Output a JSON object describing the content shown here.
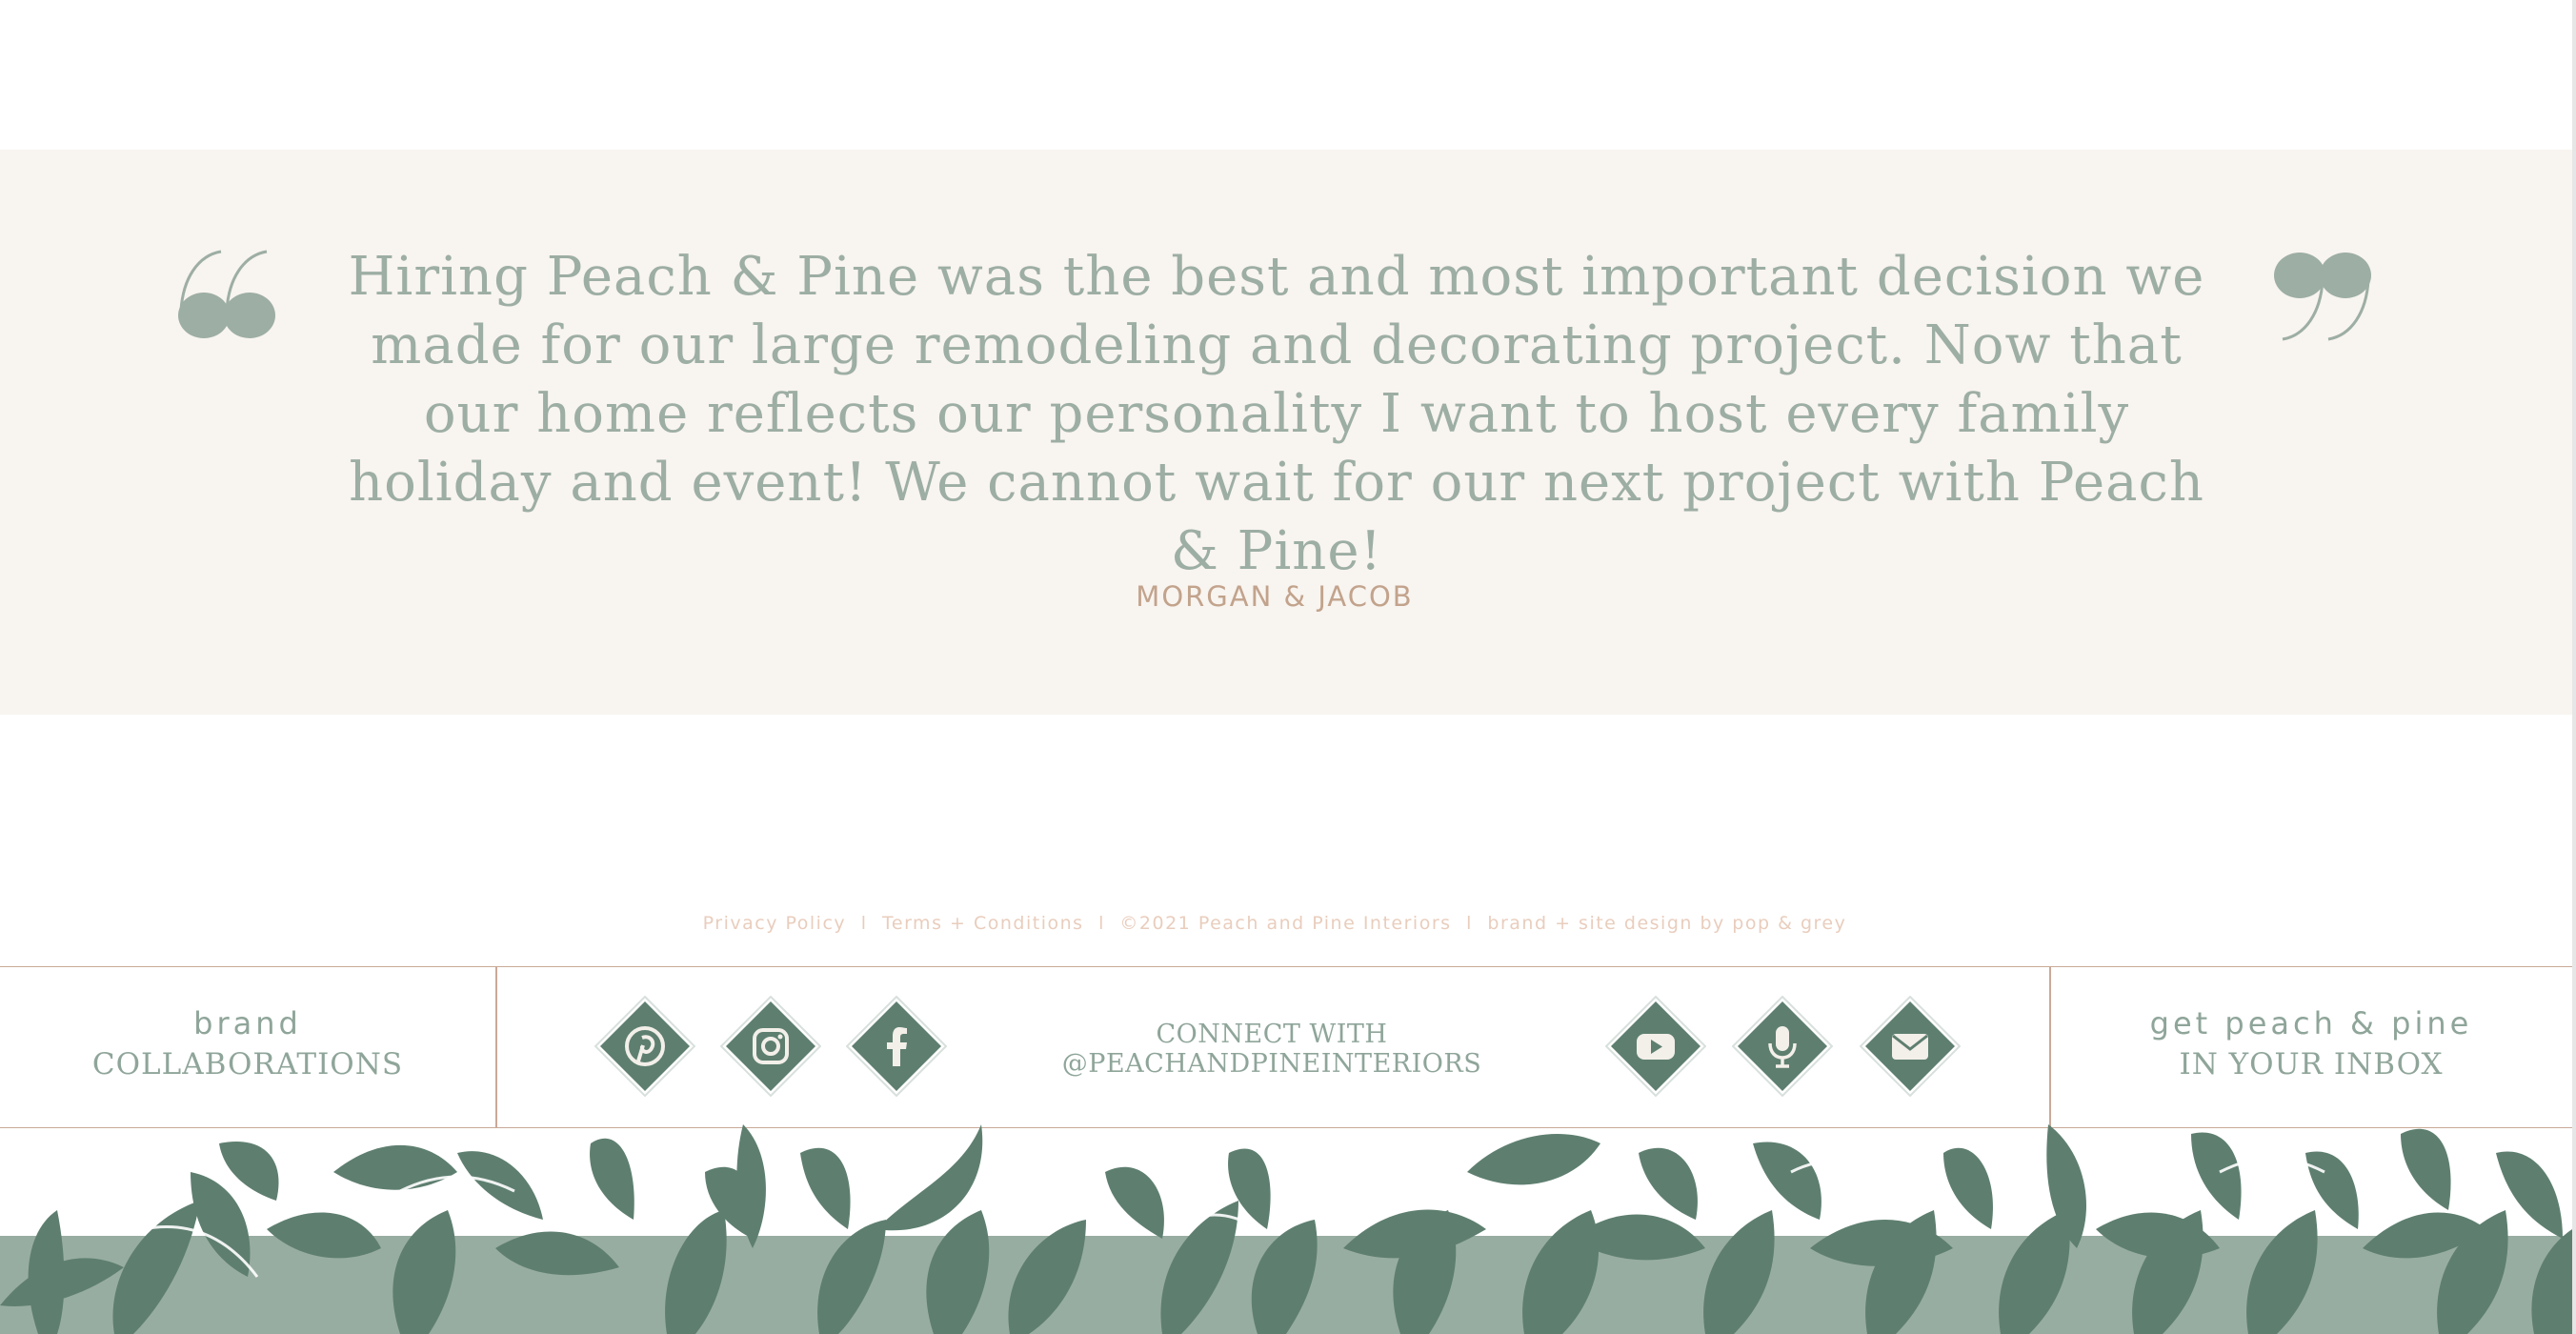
{
  "testimonial": {
    "quote": "Hiring Peach & Pine was the best and most important decision we made for our large remodeling and decorating project. Now that our home reflects our personality I want to host every family holiday and event! We cannot wait for our next project with Peach & Pine!",
    "author": "MORGAN & JACOB",
    "quote_icon": "quotation-mark-icon"
  },
  "footer_legal": {
    "privacy": "Privacy Policy",
    "terms": "Terms + Conditions",
    "copyright": "©2021 Peach and Pine Interiors",
    "credit": "brand + site design by pop & grey",
    "separator": "l"
  },
  "footer": {
    "collab": {
      "small": "brand",
      "big": "COLLABORATIONS"
    },
    "connect": {
      "line1": "CONNECT WITH",
      "line2": "@PEACHANDPINEINTERIORS"
    },
    "inbox": {
      "small": "get peach & pine",
      "big": "IN YOUR INBOX"
    },
    "social_left": [
      "pinterest-icon",
      "instagram-icon",
      "facebook-icon"
    ],
    "social_right": [
      "youtube-icon",
      "podcast-microphone-icon",
      "email-icon"
    ]
  },
  "colors": {
    "sage": "#8fa59a",
    "dark_green": "#5e7f70",
    "band_green": "#98ada1",
    "cream": "#f8f4f0",
    "peach": "#c2a38c",
    "rule": "#c9a998"
  }
}
